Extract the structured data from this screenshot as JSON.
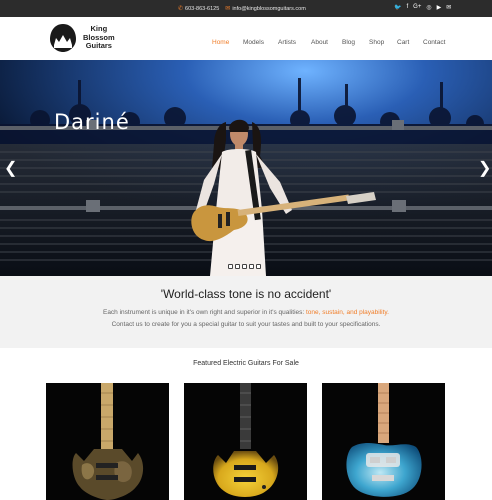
{
  "topbar": {
    "phone": "603-863-6125",
    "email": "info@kingblossomguitars.com",
    "social_icons": [
      "twitter-icon",
      "facebook-icon",
      "google-plus-icon",
      "instagram-icon",
      "youtube-icon",
      "email-icon"
    ],
    "social_glyphs": [
      "🐦",
      "f",
      "G+",
      "◎",
      "▶",
      "✉"
    ]
  },
  "logo": {
    "line1": "King",
    "line2": "Blossom",
    "line3": "Guitars"
  },
  "nav": {
    "items": [
      "Home",
      "Models",
      "Artists",
      "About",
      "Blog",
      "Shop",
      "Cart",
      "Contact"
    ],
    "active": "Home"
  },
  "hero": {
    "title": "Dariné",
    "prev_glyph": "❮",
    "next_glyph": "❯",
    "slide_count": 5
  },
  "intro": {
    "heading": "'World-class tone is no accident'",
    "line1_before": "Each instrument is unique in it's own right and superior in it's qualities: ",
    "line1_highlight": "tone, sustain, and playability.",
    "line2": "Contact us to create for you a special guitar to suit your tastes and built to your specifications."
  },
  "featured": {
    "heading": "Featured Electric Guitars For Sale",
    "products": [
      {
        "finish": "natural-burl"
      },
      {
        "finish": "yellow-burst"
      },
      {
        "finish": "blue-quilt"
      }
    ]
  },
  "colors": {
    "accent": "#f07e2a",
    "topbar": "#2c2c2c",
    "intro_bg": "#f2f2f2"
  }
}
